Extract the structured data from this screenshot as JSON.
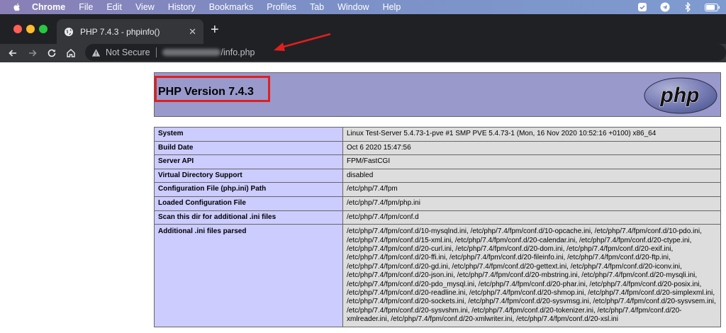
{
  "menubar": {
    "items": [
      "Chrome",
      "File",
      "Edit",
      "View",
      "History",
      "Bookmarks",
      "Profiles",
      "Tab",
      "Window",
      "Help"
    ],
    "status_icons": [
      "shield-check-icon",
      "telegram-icon",
      "bluetooth-icon",
      "battery-icon"
    ]
  },
  "browser": {
    "tab_title": "PHP 7.4.3 - phpinfo()",
    "tab_close": "✕",
    "new_tab": "+",
    "security_label": "Not Secure",
    "url_path": "/info.php"
  },
  "colors": {
    "header_bg": "#9999cc",
    "label_bg": "#ccccff",
    "value_bg": "#dddddd",
    "highlight": "#e01f1f"
  },
  "page": {
    "title": "PHP Version 7.4.3",
    "logo_text": "php",
    "rows": [
      {
        "label": "System",
        "value": "Linux Test-Server 5.4.73-1-pve #1 SMP PVE 5.4.73-1 (Mon, 16 Nov 2020 10:52:16 +0100) x86_64"
      },
      {
        "label": "Build Date",
        "value": "Oct 6 2020 15:47:56"
      },
      {
        "label": "Server API",
        "value": "FPM/FastCGI"
      },
      {
        "label": "Virtual Directory Support",
        "value": "disabled"
      },
      {
        "label": "Configuration File (php.ini) Path",
        "value": "/etc/php/7.4/fpm"
      },
      {
        "label": "Loaded Configuration File",
        "value": "/etc/php/7.4/fpm/php.ini"
      },
      {
        "label": "Scan this dir for additional .ini files",
        "value": "/etc/php/7.4/fpm/conf.d"
      },
      {
        "label": "Additional .ini files parsed",
        "value": "/etc/php/7.4/fpm/conf.d/10-mysqlnd.ini, /etc/php/7.4/fpm/conf.d/10-opcache.ini, /etc/php/7.4/fpm/conf.d/10-pdo.ini, /etc/php/7.4/fpm/conf.d/15-xml.ini, /etc/php/7.4/fpm/conf.d/20-calendar.ini, /etc/php/7.4/fpm/conf.d/20-ctype.ini, /etc/php/7.4/fpm/conf.d/20-curl.ini, /etc/php/7.4/fpm/conf.d/20-dom.ini, /etc/php/7.4/fpm/conf.d/20-exif.ini, /etc/php/7.4/fpm/conf.d/20-ffi.ini, /etc/php/7.4/fpm/conf.d/20-fileinfo.ini, /etc/php/7.4/fpm/conf.d/20-ftp.ini, /etc/php/7.4/fpm/conf.d/20-gd.ini, /etc/php/7.4/fpm/conf.d/20-gettext.ini, /etc/php/7.4/fpm/conf.d/20-iconv.ini, /etc/php/7.4/fpm/conf.d/20-json.ini, /etc/php/7.4/fpm/conf.d/20-mbstring.ini, /etc/php/7.4/fpm/conf.d/20-mysqli.ini, /etc/php/7.4/fpm/conf.d/20-pdo_mysql.ini, /etc/php/7.4/fpm/conf.d/20-phar.ini, /etc/php/7.4/fpm/conf.d/20-posix.ini, /etc/php/7.4/fpm/conf.d/20-readline.ini, /etc/php/7.4/fpm/conf.d/20-shmop.ini, /etc/php/7.4/fpm/conf.d/20-simplexml.ini, /etc/php/7.4/fpm/conf.d/20-sockets.ini, /etc/php/7.4/fpm/conf.d/20-sysvmsg.ini, /etc/php/7.4/fpm/conf.d/20-sysvsem.ini, /etc/php/7.4/fpm/conf.d/20-sysvshm.ini, /etc/php/7.4/fpm/conf.d/20-tokenizer.ini, /etc/php/7.4/fpm/conf.d/20-xmlreader.ini, /etc/php/7.4/fpm/conf.d/20-xmlwriter.ini, /etc/php/7.4/fpm/conf.d/20-xsl.ini"
      }
    ]
  }
}
